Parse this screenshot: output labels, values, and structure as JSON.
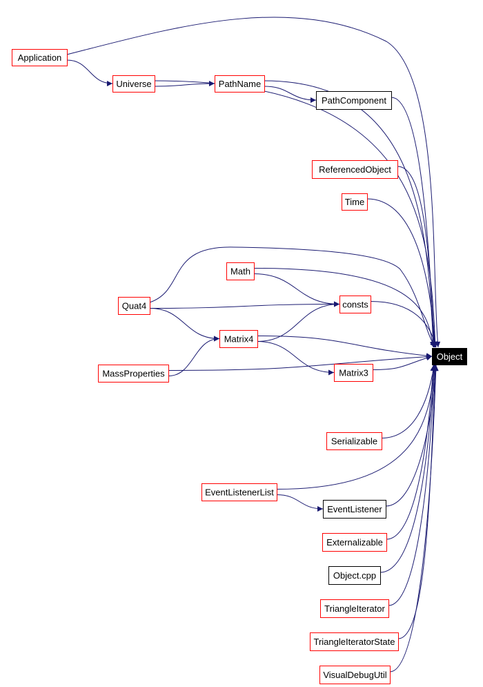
{
  "colors": {
    "edge": "#191970",
    "linked_border": "#ff0000",
    "plain_border": "#000000",
    "root_fill": "#000000",
    "root_text": "#ffffff"
  },
  "nodes": [
    {
      "id": "Application",
      "label": "Application",
      "border": "red"
    },
    {
      "id": "Universe",
      "label": "Universe",
      "border": "red"
    },
    {
      "id": "PathName",
      "label": "PathName",
      "border": "red"
    },
    {
      "id": "PathComponent",
      "label": "PathComponent",
      "border": "black"
    },
    {
      "id": "ReferencedObject",
      "label": "ReferencedObject",
      "border": "red"
    },
    {
      "id": "Time",
      "label": "Time",
      "border": "red"
    },
    {
      "id": "Math",
      "label": "Math",
      "border": "red"
    },
    {
      "id": "Quat4",
      "label": "Quat4",
      "border": "red"
    },
    {
      "id": "consts",
      "label": "consts",
      "border": "red"
    },
    {
      "id": "Matrix4",
      "label": "Matrix4",
      "border": "red"
    },
    {
      "id": "MassProperties",
      "label": "MassProperties",
      "border": "red"
    },
    {
      "id": "Matrix3",
      "label": "Matrix3",
      "border": "red"
    },
    {
      "id": "Object",
      "label": "Object",
      "border": "root"
    },
    {
      "id": "Serializable",
      "label": "Serializable",
      "border": "red"
    },
    {
      "id": "EventListenerList",
      "label": "EventListenerList",
      "border": "red"
    },
    {
      "id": "EventListener",
      "label": "EventListener",
      "border": "black"
    },
    {
      "id": "Externalizable",
      "label": "Externalizable",
      "border": "red"
    },
    {
      "id": "ObjectCpp",
      "label": "Object.cpp",
      "border": "black"
    },
    {
      "id": "TriangleIterator",
      "label": "TriangleIterator",
      "border": "red"
    },
    {
      "id": "TriangleIteratorState",
      "label": "TriangleIteratorState",
      "border": "red"
    },
    {
      "id": "VisualDebugUtil",
      "label": "VisualDebugUtil",
      "border": "red"
    }
  ],
  "edges": [
    [
      "Application",
      "Universe"
    ],
    [
      "Application",
      "Object"
    ],
    [
      "Universe",
      "PathName"
    ],
    [
      "Universe",
      "Object"
    ],
    [
      "PathName",
      "PathComponent"
    ],
    [
      "PathName",
      "Object"
    ],
    [
      "PathComponent",
      "Object"
    ],
    [
      "ReferencedObject",
      "Object"
    ],
    [
      "Time",
      "Object"
    ],
    [
      "Math",
      "consts"
    ],
    [
      "Math",
      "Object"
    ],
    [
      "Quat4",
      "consts"
    ],
    [
      "Quat4",
      "Matrix4"
    ],
    [
      "Quat4",
      "Object"
    ],
    [
      "consts",
      "Object"
    ],
    [
      "Matrix4",
      "consts"
    ],
    [
      "Matrix4",
      "Object"
    ],
    [
      "Matrix4",
      "Matrix3"
    ],
    [
      "MassProperties",
      "Matrix4"
    ],
    [
      "MassProperties",
      "Object"
    ],
    [
      "Matrix3",
      "Object"
    ],
    [
      "Serializable",
      "Object"
    ],
    [
      "EventListenerList",
      "Object"
    ],
    [
      "EventListenerList",
      "EventListener"
    ],
    [
      "EventListener",
      "Object"
    ],
    [
      "Externalizable",
      "Object"
    ],
    [
      "ObjectCpp",
      "Object"
    ],
    [
      "TriangleIterator",
      "Object"
    ],
    [
      "TriangleIteratorState",
      "Object"
    ],
    [
      "VisualDebugUtil",
      "Object"
    ]
  ]
}
